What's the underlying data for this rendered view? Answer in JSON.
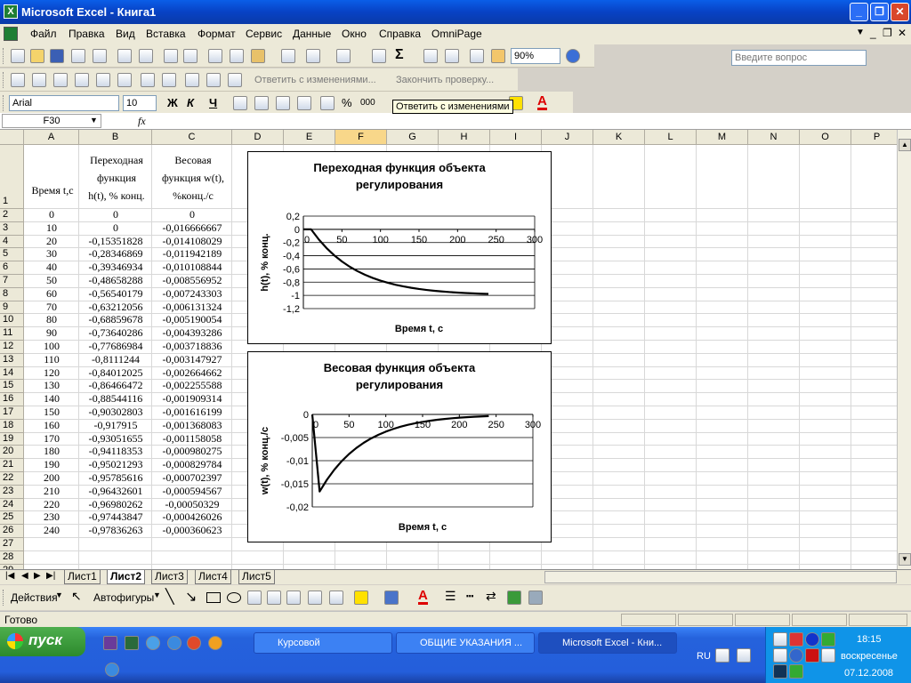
{
  "window": {
    "title": "Microsoft Excel - Книга1"
  },
  "menu": {
    "items": [
      "Файл",
      "Правка",
      "Вид",
      "Вставка",
      "Формат",
      "Сервис",
      "Данные",
      "Окно",
      "Справка",
      "OmniPage"
    ],
    "ask_placeholder": "Введите вопрос"
  },
  "toolbar": {
    "zoom": "90%",
    "review_reply": "Ответить с изменениями...",
    "review_end": "Закончить проверку...",
    "font_name": "Arial",
    "font_size": "10",
    "bold": "Ж",
    "italic": "К",
    "underline": "Ч",
    "percent": "%",
    "thousands": "000",
    "tooltip": "Ответить с изменениями"
  },
  "formula_bar": {
    "name_box": "F30",
    "fx": "fx"
  },
  "sheet": {
    "columns": [
      "A",
      "B",
      "C",
      "D",
      "E",
      "F",
      "G",
      "H",
      "I",
      "J",
      "K",
      "L",
      "M",
      "N",
      "O",
      "P"
    ],
    "header_row": {
      "a": [
        "Время t,c"
      ],
      "b": [
        "Переходная",
        "функция",
        "h(t), % конц."
      ],
      "c": [
        "Весовая",
        "функция w(t),",
        "%конц./с"
      ]
    },
    "rows": [
      [
        "0",
        "0",
        "0"
      ],
      [
        "10",
        "0",
        "-0,016666667"
      ],
      [
        "20",
        "-0,15351828",
        "-0,014108029"
      ],
      [
        "30",
        "-0,28346869",
        "-0,011942189"
      ],
      [
        "40",
        "-0,39346934",
        "-0,010108844"
      ],
      [
        "50",
        "-0,48658288",
        "-0,008556952"
      ],
      [
        "60",
        "-0,56540179",
        "-0,007243303"
      ],
      [
        "70",
        "-0,63212056",
        "-0,006131324"
      ],
      [
        "80",
        "-0,68859678",
        "-0,005190054"
      ],
      [
        "90",
        "-0,73640286",
        "-0,004393286"
      ],
      [
        "100",
        "-0,77686984",
        "-0,003718836"
      ],
      [
        "110",
        "-0,8111244",
        "-0,003147927"
      ],
      [
        "120",
        "-0,84012025",
        "-0,002664662"
      ],
      [
        "130",
        "-0,86466472",
        "-0,002255588"
      ],
      [
        "140",
        "-0,88544116",
        "-0,001909314"
      ],
      [
        "150",
        "-0,90302803",
        "-0,001616199"
      ],
      [
        "160",
        "-0,917915",
        "-0,001368083"
      ],
      [
        "170",
        "-0,93051655",
        "-0,001158058"
      ],
      [
        "180",
        "-0,94118353",
        "-0,000980275"
      ],
      [
        "190",
        "-0,95021293",
        "-0,000829784"
      ],
      [
        "200",
        "-0,95785616",
        "-0,000702397"
      ],
      [
        "210",
        "-0,96432601",
        "-0,000594567"
      ],
      [
        "220",
        "-0,96980262",
        "-0,00050329"
      ],
      [
        "230",
        "-0,97443847",
        "-0,000426026"
      ],
      [
        "240",
        "-0,97836263",
        "-0,000360623"
      ]
    ],
    "row_numbers": [
      "1",
      "2",
      "3",
      "4",
      "5",
      "6",
      "7",
      "8",
      "9",
      "10",
      "11",
      "12",
      "13",
      "14",
      "15",
      "16",
      "17",
      "18",
      "19",
      "20",
      "21",
      "22",
      "23",
      "24",
      "25",
      "26",
      "27",
      "28",
      "29"
    ]
  },
  "chart_data": [
    {
      "type": "line",
      "title": "Переходная функция объекта регулирования",
      "title_lines": [
        "Переходная функция объекта",
        "регулирования"
      ],
      "xlabel": "Время t, c",
      "ylabel": "h(t), % конц.",
      "xlim": [
        0,
        300
      ],
      "ylim": [
        -1.2,
        0.2
      ],
      "xticks": [
        "0",
        "50",
        "100",
        "150",
        "200",
        "250",
        "300"
      ],
      "yticks": [
        "0,2",
        "0",
        "-0,2",
        "-0,4",
        "-0,6",
        "-0,8",
        "-1",
        "-1,2"
      ],
      "x": [
        0,
        10,
        20,
        30,
        40,
        50,
        60,
        70,
        80,
        90,
        100,
        110,
        120,
        130,
        140,
        150,
        160,
        170,
        180,
        190,
        200,
        210,
        220,
        230,
        240
      ],
      "values": [
        0,
        0,
        -0.15351828,
        -0.28346869,
        -0.39346934,
        -0.48658288,
        -0.56540179,
        -0.63212056,
        -0.68859678,
        -0.73640286,
        -0.77686984,
        -0.8111244,
        -0.84012025,
        -0.86466472,
        -0.88544116,
        -0.90302803,
        -0.917915,
        -0.93051655,
        -0.94118353,
        -0.95021293,
        -0.95785616,
        -0.96432601,
        -0.96980262,
        -0.97443847,
        -0.97836263
      ],
      "grid": true,
      "legend": "none"
    },
    {
      "type": "line",
      "title": "Весовая функция объекта регулирования",
      "title_lines": [
        "Весовая функция объекта",
        "регулирования"
      ],
      "xlabel": "Время t, c",
      "ylabel": "w(t), % конц./c",
      "xlim": [
        0,
        300
      ],
      "ylim": [
        -0.02,
        0
      ],
      "xticks": [
        "0",
        "50",
        "100",
        "150",
        "200",
        "250",
        "300"
      ],
      "yticks": [
        "0",
        "-0,005",
        "-0,01",
        "-0,015",
        "-0,02"
      ],
      "x": [
        0,
        10,
        20,
        30,
        40,
        50,
        60,
        70,
        80,
        90,
        100,
        110,
        120,
        130,
        140,
        150,
        160,
        170,
        180,
        190,
        200,
        210,
        220,
        230,
        240
      ],
      "values": [
        0,
        -0.016666667,
        -0.014108029,
        -0.011942189,
        -0.010108844,
        -0.008556952,
        -0.007243303,
        -0.006131324,
        -0.005190054,
        -0.004393286,
        -0.003718836,
        -0.003147927,
        -0.002664662,
        -0.002255588,
        -0.001909314,
        -0.001616199,
        -0.001368083,
        -0.001158058,
        -0.000980275,
        -0.000829784,
        -0.000702397,
        -0.000594567,
        -0.00050329,
        -0.000426026,
        -0.000360623
      ],
      "grid": true,
      "legend": "none"
    }
  ],
  "tabs": [
    "Лист1",
    "Лист2",
    "Лист3",
    "Лист4",
    "Лист5"
  ],
  "active_tab": "Лист2",
  "drawing": {
    "actions": "Действия",
    "autoshapes": "Автофигуры"
  },
  "status": {
    "text": "Готово"
  },
  "taskbar": {
    "start": "пуск",
    "tasks": [
      "Курсовой",
      "ОБЩИЕ УКАЗАНИЯ ...",
      "Microsoft Excel - Кни..."
    ],
    "lang": "RU",
    "time": "18:15",
    "day": "воскресенье",
    "date": "07.12.2008"
  }
}
